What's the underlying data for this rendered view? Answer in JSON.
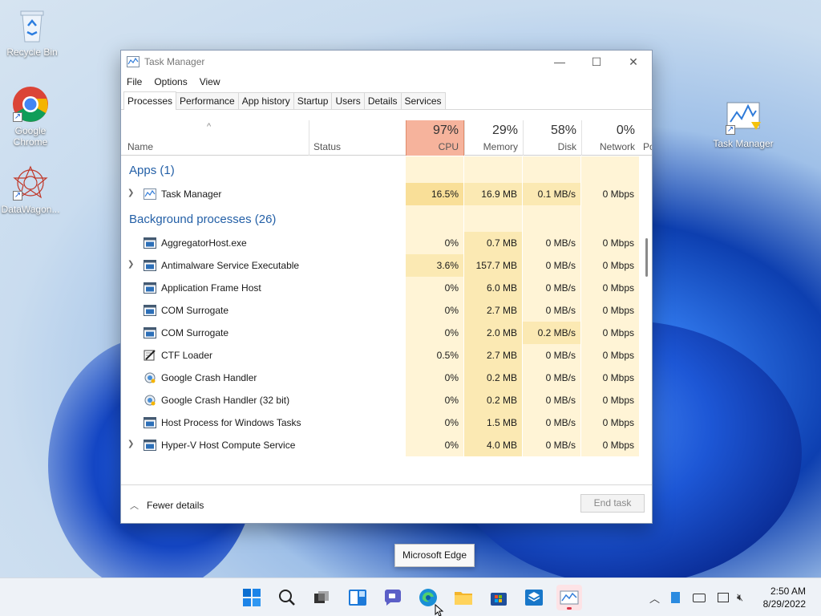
{
  "desktop": {
    "icons": [
      {
        "label": "Recycle Bin",
        "icon": "recycle-bin-icon"
      },
      {
        "label": "Google Chrome",
        "icon": "chrome-icon"
      },
      {
        "label": "DataWagon...",
        "icon": "datawagon-icon"
      },
      {
        "label": "Task Manager",
        "icon": "task-manager-icon"
      }
    ]
  },
  "window": {
    "title": "Task Manager",
    "controls": {
      "minimize": "—",
      "maximize": "☐",
      "close": "✕"
    },
    "menu": [
      "File",
      "Options",
      "View"
    ],
    "tabs": [
      "Processes",
      "Performance",
      "App history",
      "Startup",
      "Users",
      "Details",
      "Services"
    ],
    "active_tab": "Processes",
    "columns": {
      "name": "Name",
      "status": "Status",
      "cpu": {
        "pct": "97%",
        "label": "CPU"
      },
      "memory": {
        "pct": "29%",
        "label": "Memory"
      },
      "disk": {
        "pct": "58%",
        "label": "Disk"
      },
      "network": {
        "pct": "0%",
        "label": "Network"
      },
      "power": "Po"
    },
    "groups": {
      "apps": "Apps (1)",
      "background": "Background processes (26)"
    },
    "apps": [
      {
        "name": "Task Manager",
        "expandable": true,
        "icon": "task-manager-icon",
        "cpu": "16.5%",
        "memory": "16.9 MB",
        "disk": "0.1 MB/s",
        "network": "0 Mbps"
      }
    ],
    "background": [
      {
        "name": "AggregatorHost.exe",
        "expandable": false,
        "icon": "process-window-icon",
        "cpu": "0%",
        "memory": "0.7 MB",
        "disk": "0 MB/s",
        "network": "0 Mbps"
      },
      {
        "name": "Antimalware Service Executable",
        "expandable": true,
        "icon": "process-window-icon",
        "cpu": "3.6%",
        "memory": "157.7 MB",
        "disk": "0 MB/s",
        "network": "0 Mbps"
      },
      {
        "name": "Application Frame Host",
        "expandable": false,
        "icon": "process-window-icon",
        "cpu": "0%",
        "memory": "6.0 MB",
        "disk": "0 MB/s",
        "network": "0 Mbps"
      },
      {
        "name": "COM Surrogate",
        "expandable": false,
        "icon": "process-window-icon",
        "cpu": "0%",
        "memory": "2.7 MB",
        "disk": "0 MB/s",
        "network": "0 Mbps"
      },
      {
        "name": "COM Surrogate",
        "expandable": false,
        "icon": "process-window-icon",
        "cpu": "0%",
        "memory": "2.0 MB",
        "disk": "0.2 MB/s",
        "network": "0 Mbps"
      },
      {
        "name": "CTF Loader",
        "expandable": false,
        "icon": "ctf-loader-icon",
        "cpu": "0.5%",
        "memory": "2.7 MB",
        "disk": "0 MB/s",
        "network": "0 Mbps"
      },
      {
        "name": "Google Crash Handler",
        "expandable": false,
        "icon": "google-crash-handler-icon",
        "cpu": "0%",
        "memory": "0.2 MB",
        "disk": "0 MB/s",
        "network": "0 Mbps"
      },
      {
        "name": "Google Crash Handler (32 bit)",
        "expandable": false,
        "icon": "google-crash-handler-icon",
        "cpu": "0%",
        "memory": "0.2 MB",
        "disk": "0 MB/s",
        "network": "0 Mbps"
      },
      {
        "name": "Host Process for Windows Tasks",
        "expandable": false,
        "icon": "process-window-icon",
        "cpu": "0%",
        "memory": "1.5 MB",
        "disk": "0 MB/s",
        "network": "0 Mbps"
      },
      {
        "name": "Hyper-V Host Compute Service",
        "expandable": true,
        "icon": "process-window-icon",
        "cpu": "0%",
        "memory": "4.0 MB",
        "disk": "0 MB/s",
        "network": "0 Mbps"
      }
    ],
    "footer": {
      "fewer_details": "Fewer details",
      "end_task": "End task"
    }
  },
  "tooltip": "Microsoft Edge",
  "taskbar": {
    "apps": [
      "start-icon",
      "search-icon",
      "task-view-icon",
      "widgets-icon",
      "chat-icon",
      "edge-icon",
      "file-explorer-icon",
      "store-icon",
      "vm-app-icon",
      "task-manager-icon"
    ],
    "clock": {
      "time": "2:50 AM",
      "date": "8/29/2022"
    }
  },
  "colors": {
    "cpu_header": "#f6b39c",
    "heat_light": "#fff4d6",
    "heat_mid": "#fbe9b3",
    "heat_high": "#f9df98",
    "link_blue": "#2460a7"
  }
}
